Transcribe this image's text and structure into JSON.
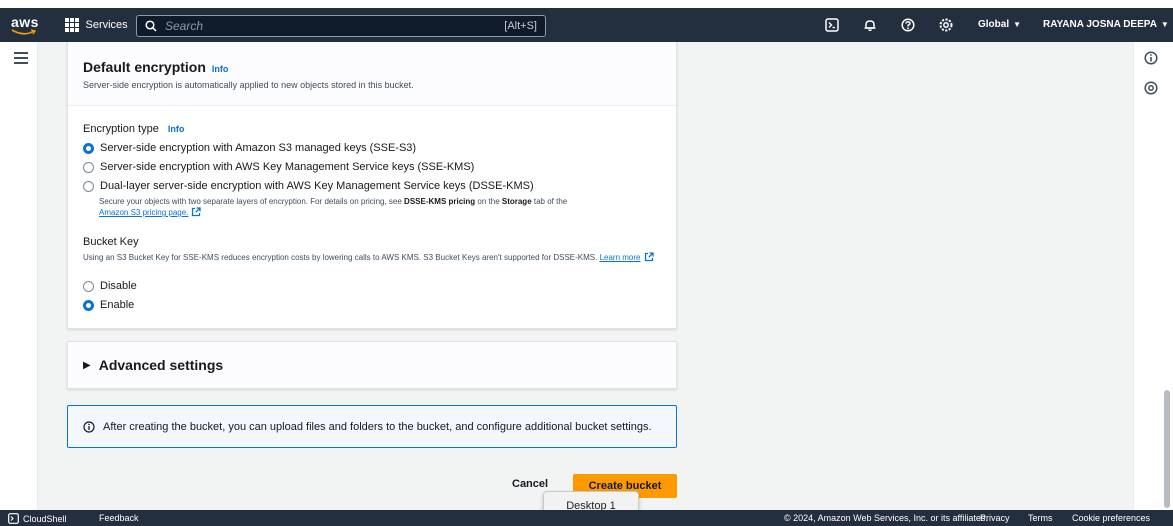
{
  "topnav": {
    "logo_text": "aws",
    "services_label": "Services",
    "search_placeholder": "Search",
    "search_shortcut": "[Alt+S]",
    "region_label": "Global",
    "account_label": "RAYANA JOSNA DEEPA",
    "icons": [
      "cloudshell-icon",
      "bell-icon",
      "help-icon",
      "gear-icon"
    ]
  },
  "encryption": {
    "title": "Default encryption",
    "info_label": "Info",
    "description": "Server-side encryption is automatically applied to new objects stored in this bucket.",
    "type_label": "Encryption type",
    "type_info": "Info",
    "options": [
      {
        "label": "Server-side encryption with Amazon S3 managed keys (SSE-S3)",
        "selected": true
      },
      {
        "label": "Server-side encryption with AWS Key Management Service keys (SSE-KMS)",
        "selected": false
      },
      {
        "label": "Dual-layer server-side encryption with AWS Key Management Service keys (DSSE-KMS)",
        "selected": false
      }
    ],
    "dsse_help_prefix": "Secure your objects with two separate layers of encryption. For details on pricing, see ",
    "dsse_help_bold1": "DSSE-KMS pricing",
    "dsse_help_mid": " on the ",
    "dsse_help_bold2": "Storage",
    "dsse_help_suffix": " tab of the",
    "dsse_help_link": "Amazon S3 pricing page.",
    "bucket_key_label": "Bucket Key",
    "bucket_key_help": "Using an S3 Bucket Key for SSE-KMS reduces encryption costs by lowering calls to AWS KMS. S3 Bucket Keys aren't supported for DSSE-KMS.",
    "bucket_key_link": "Learn more",
    "bucket_key_options": [
      {
        "label": "Disable",
        "selected": false
      },
      {
        "label": "Enable",
        "selected": true
      }
    ]
  },
  "advanced": {
    "label": "Advanced settings"
  },
  "alert": {
    "text": "After creating the bucket, you can upload files and folders to the bucket, and configure additional bucket settings."
  },
  "actions": {
    "cancel_label": "Cancel",
    "create_label": "Create bucket"
  },
  "tooltip": {
    "text": "Desktop 1"
  },
  "footer": {
    "cloudshell_label": "CloudShell",
    "feedback_label": "Feedback",
    "copyright": "© 2024, Amazon Web Services, Inc. or its affiliates.",
    "privacy_label": "Privacy",
    "terms_label": "Terms",
    "cookie_label": "Cookie preferences"
  },
  "colors": {
    "nav_bg": "#232f3e",
    "accent_blue": "#0972d3",
    "primary_orange": "#ff9900",
    "alert_bg": "#f2f8fd"
  }
}
